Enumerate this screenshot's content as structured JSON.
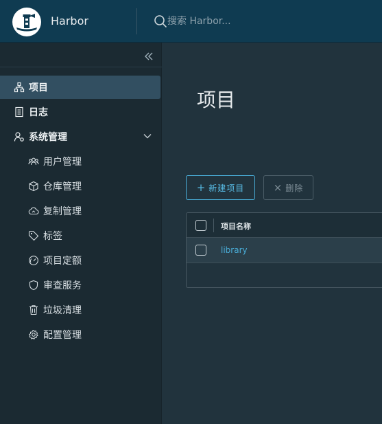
{
  "header": {
    "brand": "Harbor",
    "search_placeholder": "搜索 Harbor..."
  },
  "sidebar": {
    "items": [
      {
        "label": "项目",
        "icon": "projects-icon",
        "active": true
      },
      {
        "label": "日志",
        "icon": "logs-icon"
      },
      {
        "label": "系统管理",
        "icon": "admin-icon",
        "expanded": true
      }
    ],
    "admin_items": [
      {
        "label": "用户管理",
        "icon": "users-icon"
      },
      {
        "label": "仓库管理",
        "icon": "box-icon"
      },
      {
        "label": "复制管理",
        "icon": "cloud-sync-icon"
      },
      {
        "label": "标签",
        "icon": "tag-icon"
      },
      {
        "label": "项目定额",
        "icon": "quota-gauge-icon"
      },
      {
        "label": "审查服务",
        "icon": "shield-icon"
      },
      {
        "label": "垃圾清理",
        "icon": "trash-icon"
      },
      {
        "label": "配置管理",
        "icon": "gear-icon"
      }
    ]
  },
  "main": {
    "title": "项目",
    "new_button": "新建项目",
    "delete_button": "删除",
    "table": {
      "columns": [
        "项目名称"
      ],
      "rows": [
        {
          "name": "library"
        }
      ]
    }
  },
  "colors": {
    "header_bg": "#0f3b51",
    "sidebar_bg": "#1b2a32",
    "active_item_bg": "#324f61",
    "accent": "#4aaed9"
  }
}
